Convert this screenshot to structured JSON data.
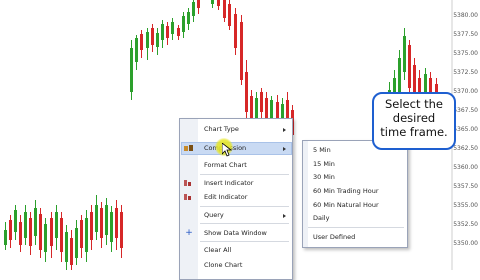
{
  "price_axis": {
    "labels": [
      "5380.00",
      "5377.50",
      "5375.00",
      "5372.50",
      "5370.00",
      "5367.50",
      "5365.00",
      "5362.50",
      "5360.00",
      "5357.50",
      "5355.00",
      "5352.50",
      "5350.00"
    ]
  },
  "context_menu": {
    "items": [
      {
        "label": "Chart Type",
        "has_submenu": true
      },
      {
        "label": "Compression",
        "has_submenu": true,
        "highlighted": true
      },
      {
        "label": "Format Chart"
      },
      {
        "label": "Insert Indicator"
      },
      {
        "label": "Edit Indicator"
      },
      {
        "label": "Query",
        "has_submenu": true
      },
      {
        "label": "Show Data Window"
      },
      {
        "label": "Clear All"
      },
      {
        "label": "Clone Chart"
      }
    ]
  },
  "compression_submenu": {
    "items": [
      "5 Min",
      "15 Min",
      "30 Min",
      "60 Min Trading Hour",
      "60 Min Natural Hour",
      "Daily",
      "User Defined"
    ]
  },
  "callout": {
    "line1": "Select the",
    "line2": "desired",
    "line3": "time frame."
  },
  "colors": {
    "up": "#2ca02c",
    "down": "#d62728",
    "menu_highlight": "#c9daf3",
    "callout_border": "#1e5fd0"
  }
}
